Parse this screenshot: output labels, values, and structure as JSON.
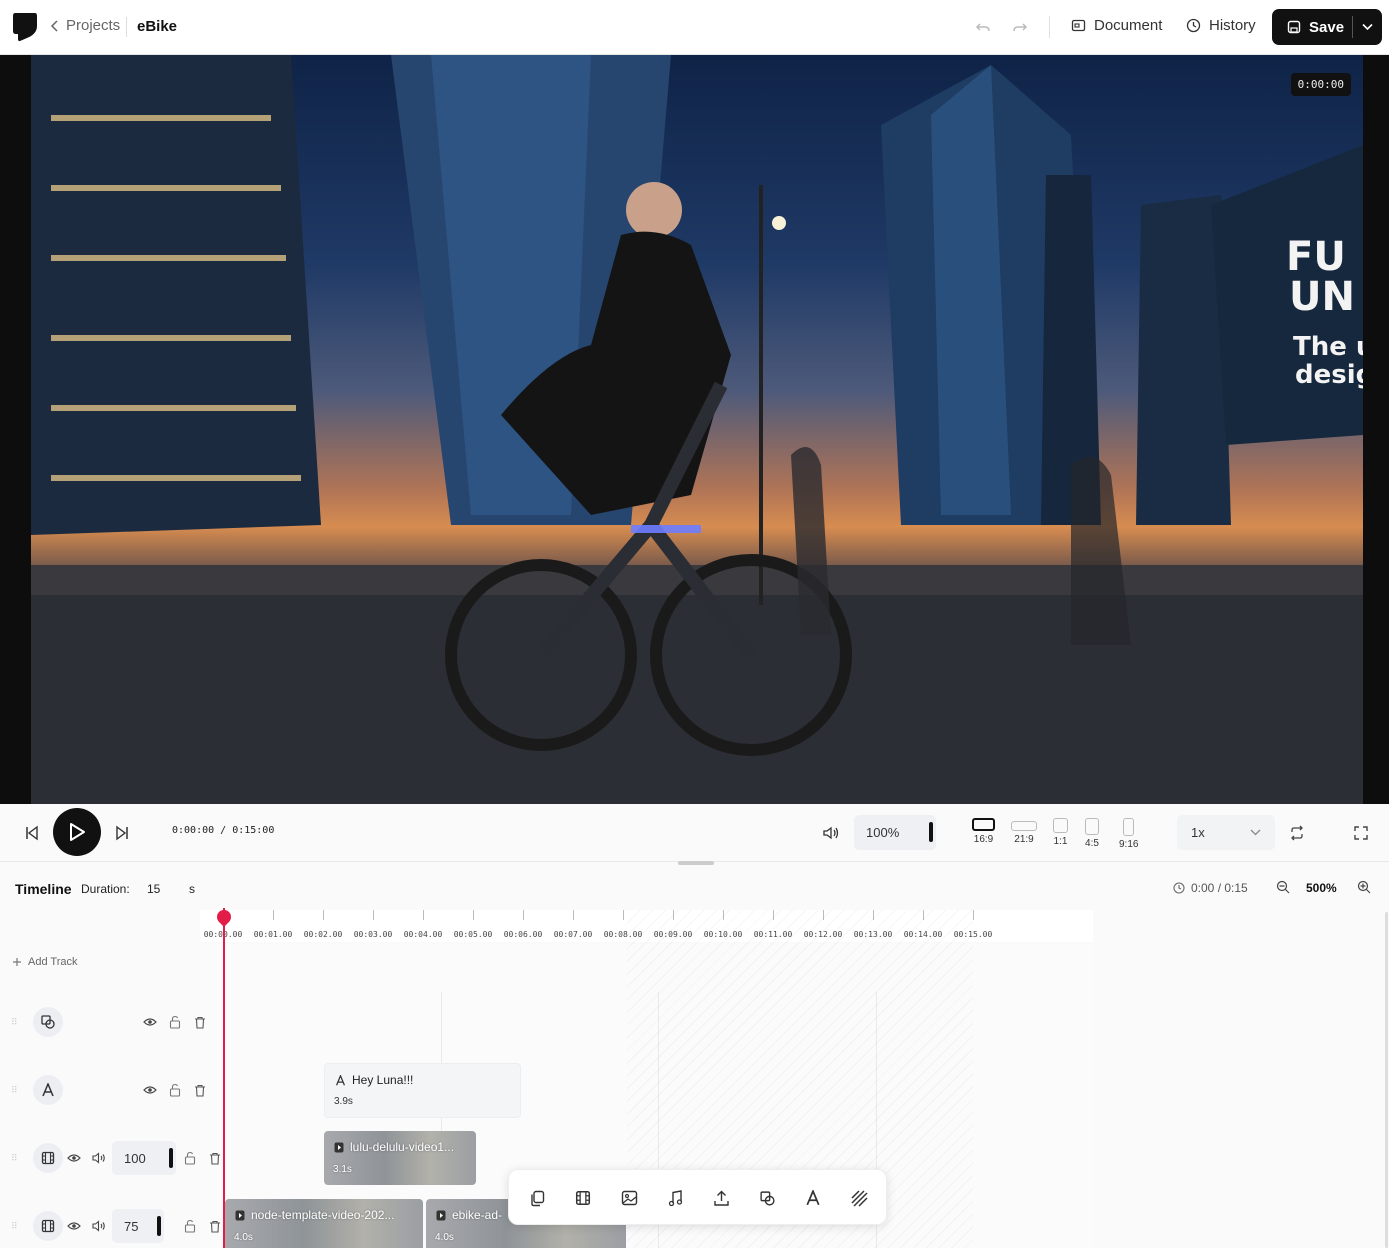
{
  "header": {
    "back_label": "Projects",
    "project_name": "eBike",
    "document_label": "Document",
    "history_label": "History",
    "save_label": "Save"
  },
  "preview": {
    "timecode": "0:00:00",
    "sign_lines": [
      "FU",
      "UN",
      "The u",
      "desig"
    ]
  },
  "player": {
    "time_display": "0:00:00 / 0:15:00",
    "volume": "100%",
    "ratios": [
      {
        "label": "16:9",
        "active": true
      },
      {
        "label": "21:9",
        "active": false
      },
      {
        "label": "1:1",
        "active": false
      },
      {
        "label": "4:5",
        "active": false
      },
      {
        "label": "9:16",
        "active": false
      }
    ],
    "speed": "1x"
  },
  "timeline": {
    "title": "Timeline",
    "duration_label": "Duration:",
    "duration_value": "15",
    "duration_unit": "s",
    "clock_readout": "0:00 / 0:15",
    "zoom": "500%",
    "add_track_label": "Add Track",
    "ticks": [
      "00:00.00",
      "00:01.00",
      "00:02.00",
      "00:03.00",
      "00:04.00",
      "00:05.00",
      "00:06.00",
      "00:07.00",
      "00:08.00",
      "00:09.00",
      "00:10.00",
      "00:11.00",
      "00:12.00",
      "00:13.00",
      "00:14.00",
      "00:15.00"
    ],
    "tracks": [
      {
        "kind": "shape",
        "icon": "shapes-icon"
      },
      {
        "kind": "text",
        "icon": "text-icon"
      },
      {
        "kind": "video",
        "icon": "film-icon",
        "volume": "100"
      },
      {
        "kind": "video",
        "icon": "film-icon",
        "volume": "75"
      }
    ],
    "clips": {
      "text_clip": {
        "title": "Hey Luna!!!",
        "duration": "3.9s"
      },
      "video_clip_1": {
        "title": "lulu-delulu-video1...",
        "duration": "3.1s"
      },
      "video_clip_2": {
        "title": "node-template-video-202...",
        "duration": "4.0s"
      },
      "video_clip_3": {
        "title": "ebike-ad-",
        "duration": "4.0s"
      }
    }
  },
  "colors": {
    "accent": "#111111",
    "playhead": "#e11d48"
  }
}
